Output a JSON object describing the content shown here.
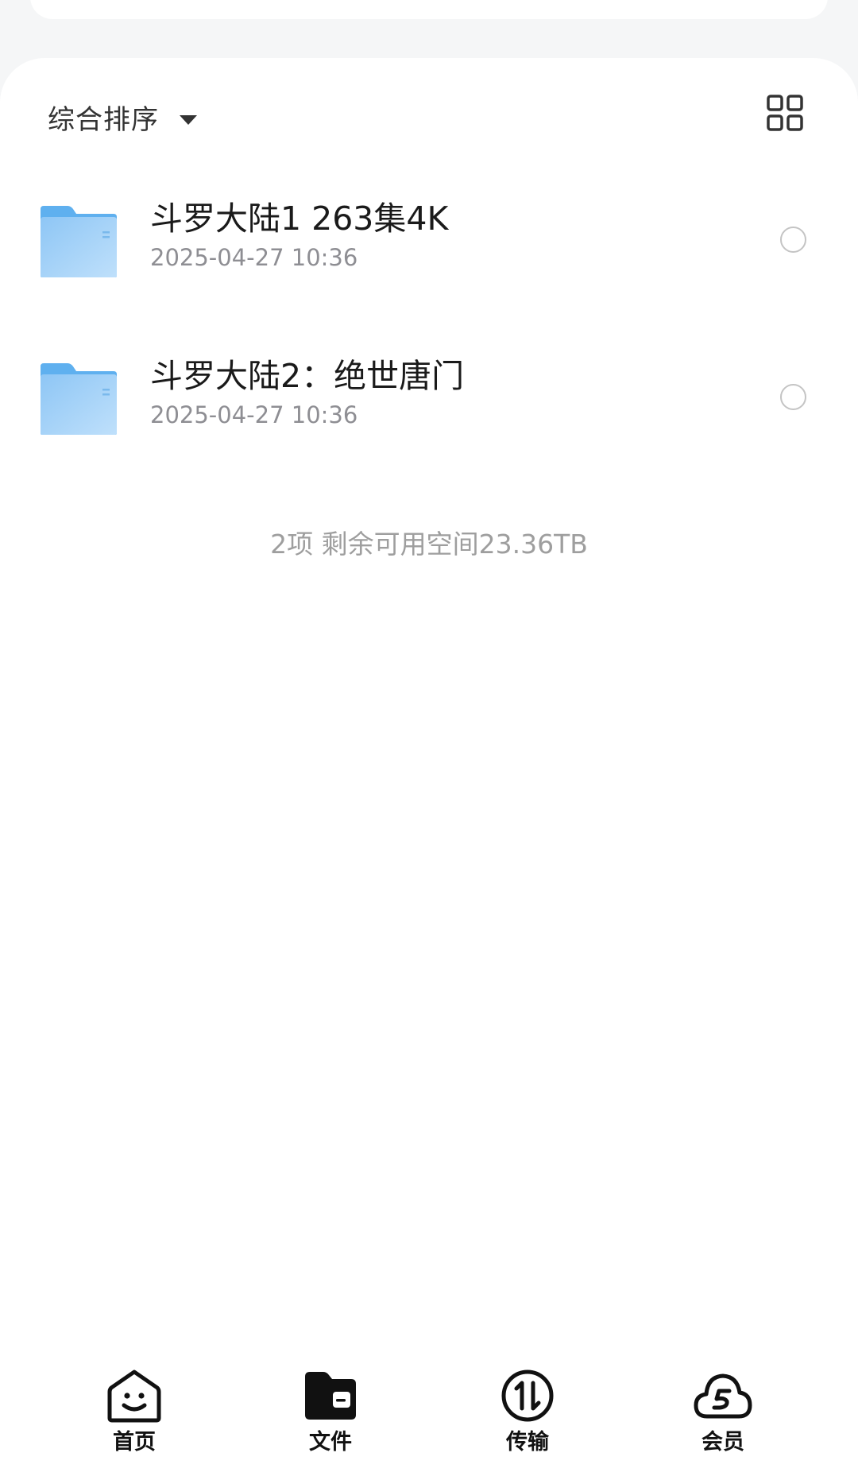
{
  "toolbar": {
    "sort_label": "综合排序"
  },
  "files": [
    {
      "name": "斗罗大陆1 263集4K",
      "date": "2025-04-27 10:36",
      "icon": "folder-icon"
    },
    {
      "name": "斗罗大陆2：绝世唐门",
      "date": "2025-04-27 10:36",
      "icon": "folder-icon"
    }
  ],
  "summary": "2项 剩余可用空间23.36TB",
  "bottom_nav": [
    {
      "label": "首页",
      "icon": "home-smile-icon",
      "active": false
    },
    {
      "label": "文件",
      "icon": "folder-filled-icon",
      "active": true
    },
    {
      "label": "传输",
      "icon": "transfer-icon",
      "active": false
    },
    {
      "label": "会员",
      "icon": "cloud-s-icon",
      "active": false
    }
  ],
  "colors": {
    "background": "#f5f6f7",
    "folder_light": "#a9d4f7",
    "folder_dark": "#5fb0ef",
    "text_primary": "#1a1a1a",
    "text_secondary": "#8e8e93"
  }
}
